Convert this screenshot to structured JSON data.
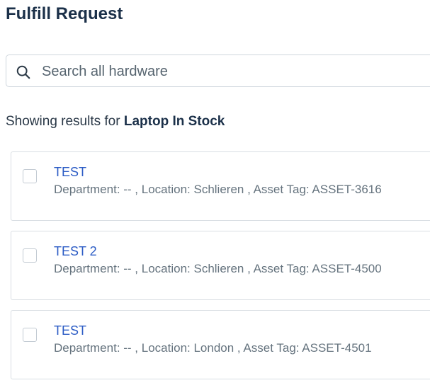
{
  "page": {
    "title": "Fulfill Request"
  },
  "search": {
    "placeholder": "Search all hardware",
    "value": ""
  },
  "results": {
    "prefix": "Showing results for",
    "query": "Laptop In Stock",
    "items": [
      {
        "title": "TEST",
        "meta": "Department: -- , Location: Schlieren , Asset Tag: ASSET-3616"
      },
      {
        "title": "TEST 2",
        "meta": "Department: -- , Location: Schlieren , Asset Tag: ASSET-4500"
      },
      {
        "title": "TEST",
        "meta": "Department: -- , Location: London , Asset Tag: ASSET-4501"
      }
    ]
  },
  "icons": {
    "search": "search-icon"
  }
}
